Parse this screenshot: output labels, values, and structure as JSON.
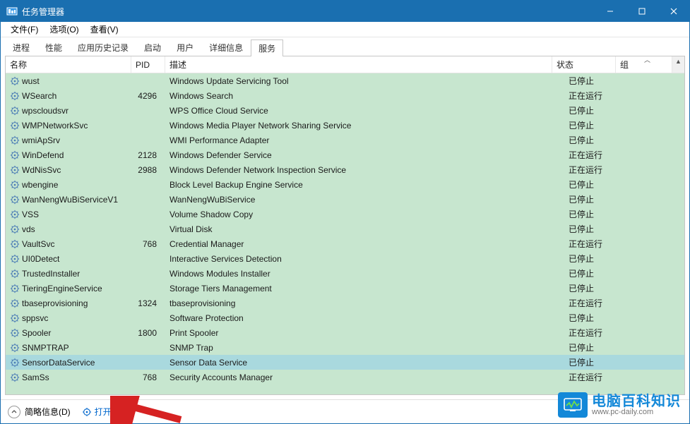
{
  "window": {
    "title": "任务管理器"
  },
  "menu": {
    "file": "文件(F)",
    "options": "选项(O)",
    "view": "查看(V)"
  },
  "tabs": {
    "items": [
      {
        "label": "进程"
      },
      {
        "label": "性能"
      },
      {
        "label": "应用历史记录"
      },
      {
        "label": "启动"
      },
      {
        "label": "用户"
      },
      {
        "label": "详细信息"
      },
      {
        "label": "服务"
      }
    ],
    "active_index": 6
  },
  "columns": {
    "name": "名称",
    "pid": "PID",
    "desc": "描述",
    "status": "状态",
    "group": "组"
  },
  "status_labels": {
    "stopped": "已停止",
    "running": "正在运行"
  },
  "services": [
    {
      "name": "wust",
      "pid": "",
      "desc": "Windows Update Servicing Tool",
      "status": "已停止"
    },
    {
      "name": "WSearch",
      "pid": "4296",
      "desc": "Windows Search",
      "status": "正在运行"
    },
    {
      "name": "wpscloudsvr",
      "pid": "",
      "desc": "WPS Office Cloud Service",
      "status": "已停止"
    },
    {
      "name": "WMPNetworkSvc",
      "pid": "",
      "desc": "Windows Media Player Network Sharing Service",
      "status": "已停止"
    },
    {
      "name": "wmiApSrv",
      "pid": "",
      "desc": "WMI Performance Adapter",
      "status": "已停止"
    },
    {
      "name": "WinDefend",
      "pid": "2128",
      "desc": "Windows Defender Service",
      "status": "正在运行"
    },
    {
      "name": "WdNisSvc",
      "pid": "2988",
      "desc": "Windows Defender Network Inspection Service",
      "status": "正在运行"
    },
    {
      "name": "wbengine",
      "pid": "",
      "desc": "Block Level Backup Engine Service",
      "status": "已停止"
    },
    {
      "name": "WanNengWuBiServiceV1",
      "pid": "",
      "desc": "WanNengWuBiService",
      "status": "已停止"
    },
    {
      "name": "VSS",
      "pid": "",
      "desc": "Volume Shadow Copy",
      "status": "已停止"
    },
    {
      "name": "vds",
      "pid": "",
      "desc": "Virtual Disk",
      "status": "已停止"
    },
    {
      "name": "VaultSvc",
      "pid": "768",
      "desc": "Credential Manager",
      "status": "正在运行"
    },
    {
      "name": "UI0Detect",
      "pid": "",
      "desc": "Interactive Services Detection",
      "status": "已停止"
    },
    {
      "name": "TrustedInstaller",
      "pid": "",
      "desc": "Windows Modules Installer",
      "status": "已停止"
    },
    {
      "name": "TieringEngineService",
      "pid": "",
      "desc": "Storage Tiers Management",
      "status": "已停止"
    },
    {
      "name": "tbaseprovisioning",
      "pid": "1324",
      "desc": "tbaseprovisioning",
      "status": "正在运行"
    },
    {
      "name": "sppsvc",
      "pid": "",
      "desc": "Software Protection",
      "status": "已停止"
    },
    {
      "name": "Spooler",
      "pid": "1800",
      "desc": "Print Spooler",
      "status": "正在运行"
    },
    {
      "name": "SNMPTRAP",
      "pid": "",
      "desc": "SNMP Trap",
      "status": "已停止"
    },
    {
      "name": "SensorDataService",
      "pid": "",
      "desc": "Sensor Data Service",
      "status": "已停止",
      "selected": true
    },
    {
      "name": "SamSs",
      "pid": "768",
      "desc": "Security Accounts Manager",
      "status": "正在运行"
    }
  ],
  "footer": {
    "details": "简略信息(D)",
    "open_services": "打开服务"
  },
  "watermark": {
    "cn": "电脑百科知识",
    "url": "www.pc-daily.com"
  }
}
